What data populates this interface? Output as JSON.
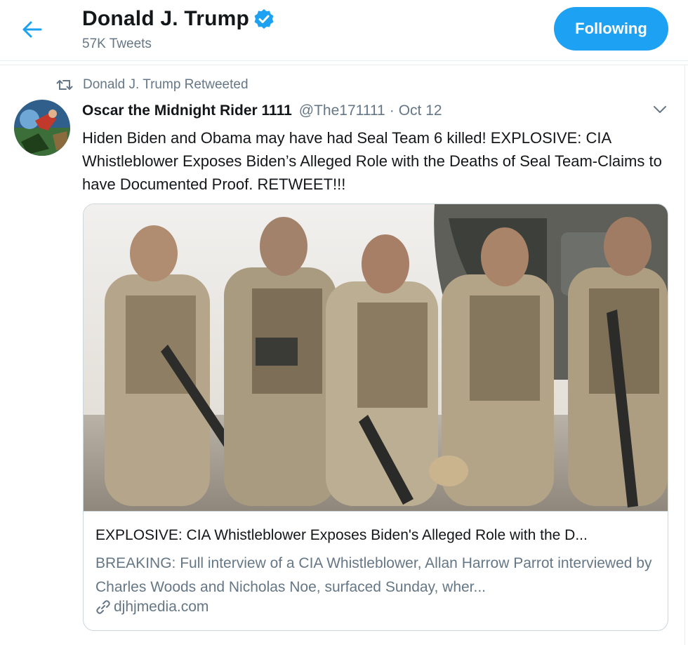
{
  "header": {
    "title": "Donald J. Trump",
    "tweet_count": "57K Tweets",
    "follow_label": "Following",
    "accent_color": "#1da1f2"
  },
  "retweet": {
    "label": "Donald J. Trump Retweeted"
  },
  "tweet": {
    "display_name": "Oscar the Midnight Rider 1111",
    "handle": "@The171111",
    "separator": "·",
    "date": "Oct 12",
    "text": "Hiden Biden and Obama may have had Seal Team 6 killed! EXPLOSIVE: CIA Whistleblower Exposes Biden’s Alleged Role with the Deaths of Seal Team-Claims to have Documented Proof. RETWEET!!!"
  },
  "card": {
    "title": "EXPLOSIVE: CIA Whistleblower Exposes Biden's Alleged Role with the D...",
    "description": "BREAKING: Full interview of a CIA Whistleblower, Allan Harrow Parrot interviewed by Charles Woods and Nicholas Noe, surfaced Sunday, wher...",
    "domain": "djhjmedia.com"
  },
  "icons": {
    "back": "back-arrow-icon",
    "verified": "verified-badge-icon",
    "retweet": "retweet-icon",
    "caret": "chevron-down-icon",
    "link": "link-icon"
  }
}
